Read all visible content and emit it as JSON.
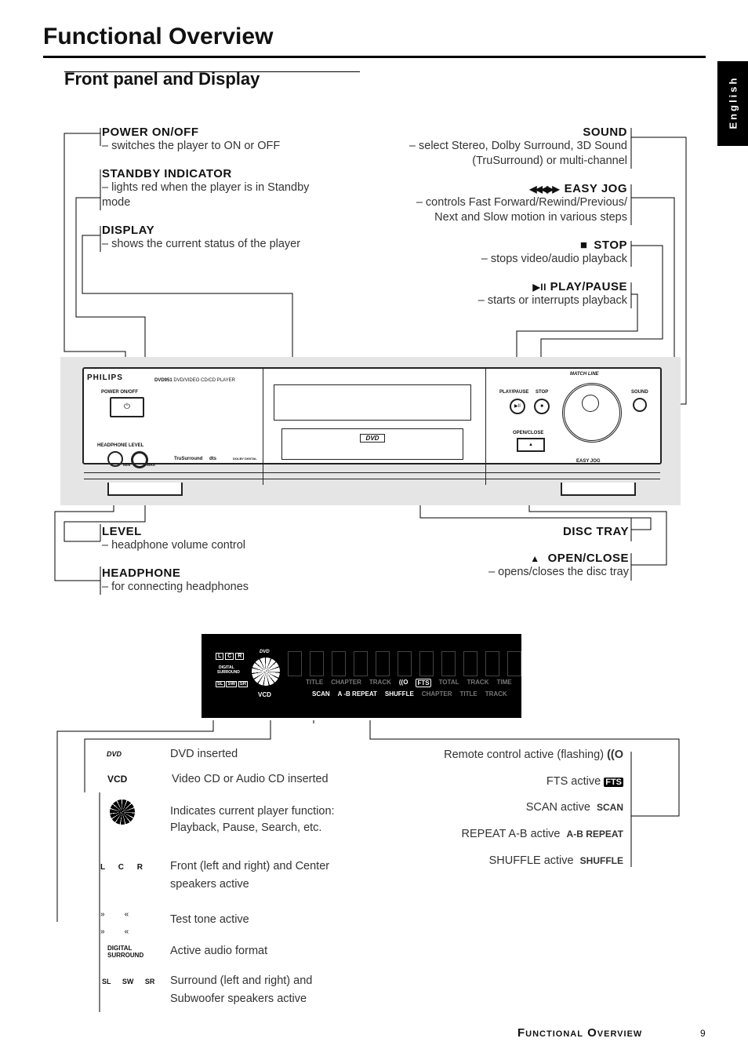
{
  "page": {
    "title": "Functional Overview",
    "section": "Front panel and Display",
    "language_tab": "English",
    "footer": "Functional Overview",
    "page_number": "9"
  },
  "callouts_left": [
    {
      "label": "POWER ON/OFF",
      "desc": "– switches the player to ON or OFF"
    },
    {
      "label": "STANDBY INDICATOR",
      "desc": "– lights red when the player is in Standby mode"
    },
    {
      "label": "DISPLAY",
      "desc": "– shows the current status of the player"
    },
    {
      "label": "LEVEL",
      "desc": "– headphone volume control"
    },
    {
      "label": "HEADPHONE",
      "desc": "– for connecting headphones"
    }
  ],
  "callouts_right": [
    {
      "label": "SOUND",
      "desc1": "– select Stereo, Dolby Surround, 3D Sound",
      "desc2": "(TruSurround) or multi-channel"
    },
    {
      "label": "EASY JOG",
      "icon": "◀◀◀▶▶",
      "desc1": "– controls Fast Forward/Rewind/Previous/",
      "desc2": "Next and Slow motion in various steps"
    },
    {
      "label": "STOP",
      "icon": "■",
      "desc1": "– stops video/audio playback"
    },
    {
      "label": "PLAY/PAUSE",
      "icon": "▶II",
      "desc1": "– starts or interrupts playback"
    },
    {
      "label": "DISC TRAY"
    },
    {
      "label": "OPEN/CLOSE",
      "icon": "▲",
      "desc1": "– opens/closes the disc tray"
    }
  ],
  "device": {
    "brand": "PHILIPS",
    "model": "DVD951",
    "model_desc": "DVD/VIDEO CD/CD PLAYER",
    "power": "POWER ON/OFF",
    "headphone": "HEADPHONE",
    "level": "LEVEL",
    "min": "MIN",
    "max": "MAX",
    "trusurround": "TruSurround",
    "dts": "dts",
    "dolby": "DOLBY DIGITAL",
    "play_pause": "PLAY/PAUSE",
    "stop": "STOP",
    "sound": "SOUND",
    "open_close": "OPEN/CLOSE",
    "easy_jog": "EASY JOG",
    "match_line": "MATCH LINE",
    "dvd_logo": "DVD"
  },
  "display": {
    "dvd": "DVD",
    "vcd": "VCD",
    "digital": "DIGITAL",
    "surround": "SURROUND",
    "speakers_top": [
      "L",
      "C",
      "R"
    ],
    "speakers_bottom": [
      "SL",
      "SW",
      "SR"
    ],
    "row1": [
      "TITLE",
      "CHAPTER",
      "TRACK",
      "((O",
      "FTS",
      "TOTAL",
      "TRACK",
      "TIME"
    ],
    "row2_active": [
      "SCAN",
      "A -B REPEAT",
      "SHUFFLE"
    ],
    "row2_dim": [
      "CHAPTER",
      "TITLE",
      "TRACK"
    ]
  },
  "legend_left": [
    {
      "icon": "DVD",
      "text": "DVD inserted"
    },
    {
      "icon": "VCD",
      "text": "Video CD or Audio CD inserted"
    },
    {
      "icon": "disc-segments",
      "text1": "Indicates current player function:",
      "text2": "Playback, Pause, Search, etc."
    },
    {
      "icon": "L C R",
      "text1": "Front (left and right) and Center",
      "text2": "speakers active"
    },
    {
      "icon": "test-tone",
      "text1": "Test tone active"
    },
    {
      "icon": "DIGITAL SURROUND",
      "text1": "Active audio format"
    },
    {
      "icon": "SL SW SR",
      "text1": "Surround (left and right) and",
      "text2": "Subwoofer speakers active"
    }
  ],
  "legend_right": [
    {
      "text": "Remote control active (flashing)",
      "icon": "((O"
    },
    {
      "text": "FTS active",
      "icon": "FTS"
    },
    {
      "text": "SCAN active",
      "icon": "SCAN"
    },
    {
      "text": "REPEAT A-B active",
      "icon": "A-B REPEAT"
    },
    {
      "text": "SHUFFLE active",
      "icon": "SHUFFLE"
    }
  ]
}
